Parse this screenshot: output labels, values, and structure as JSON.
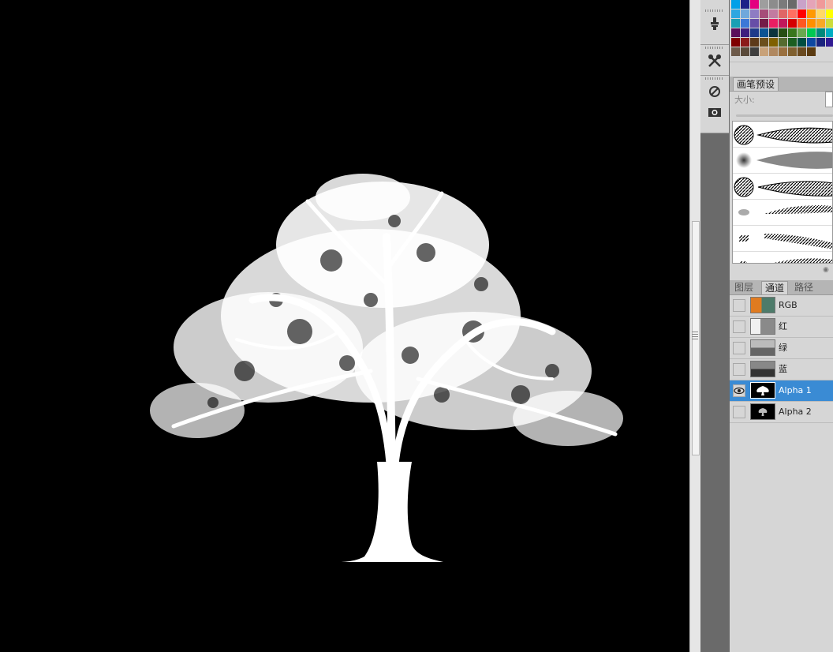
{
  "brush_panel": {
    "tab_label": "画笔预设",
    "size_label": "大小:"
  },
  "channels_panel": {
    "tabs": [
      {
        "label": "图层",
        "active": false
      },
      {
        "label": "通道",
        "active": true
      },
      {
        "label": "路径",
        "active": false
      }
    ],
    "rows": [
      {
        "label": "RGB",
        "visible": false,
        "selected": false
      },
      {
        "label": "红",
        "visible": false,
        "selected": false
      },
      {
        "label": "绿",
        "visible": false,
        "selected": false
      },
      {
        "label": "蓝",
        "visible": false,
        "selected": false
      },
      {
        "label": "Alpha 1",
        "visible": true,
        "selected": true
      },
      {
        "label": "Alpha 2",
        "visible": false,
        "selected": false
      }
    ]
  },
  "swatches": [
    "#00a0e8",
    "#1d2088",
    "#e4007f",
    "#9e9e9e",
    "#8c8c8c",
    "#7b7b7b",
    "#6a6a6a",
    "#c9a2c9",
    "#e5a4b8",
    "#f09999",
    "#f5b5a5",
    "#2ea7e0",
    "#6fa8dc",
    "#8e7cc3",
    "#a64d79",
    "#c27ba0",
    "#e06666",
    "#ff6f61",
    "#ff0000",
    "#ff9900",
    "#ffd966",
    "#ffff00",
    "#1a9fb4",
    "#3c78d8",
    "#674ea7",
    "#741b47",
    "#e91e63",
    "#c2185b",
    "#d50000",
    "#ff5722",
    "#ff8f00",
    "#f9a825",
    "#cddc39",
    "#5b0f5b",
    "#3f1f7f",
    "#1e3a8a",
    "#0b5394",
    "#0c343d",
    "#274e13",
    "#38761d",
    "#6aa84f",
    "#00c853",
    "#00897b",
    "#00acc1",
    "#7f0000",
    "#8b1a1a",
    "#5d3a1a",
    "#6b4f1d",
    "#7f6000",
    "#556b2f",
    "#1b5e20",
    "#004d40",
    "#0d47a1",
    "#1a237e",
    "#311b92",
    "#6d5a4a",
    "#5a4a3a",
    "#3e3e3e",
    "#c8a27a",
    "#b08860",
    "#9a7040",
    "#806030",
    "#6a4a20",
    "#5a3a10"
  ],
  "colors": {
    "selection": "#3a8bd4",
    "panel_bg": "#d6d6d6",
    "canvas_bg": "#000000"
  }
}
